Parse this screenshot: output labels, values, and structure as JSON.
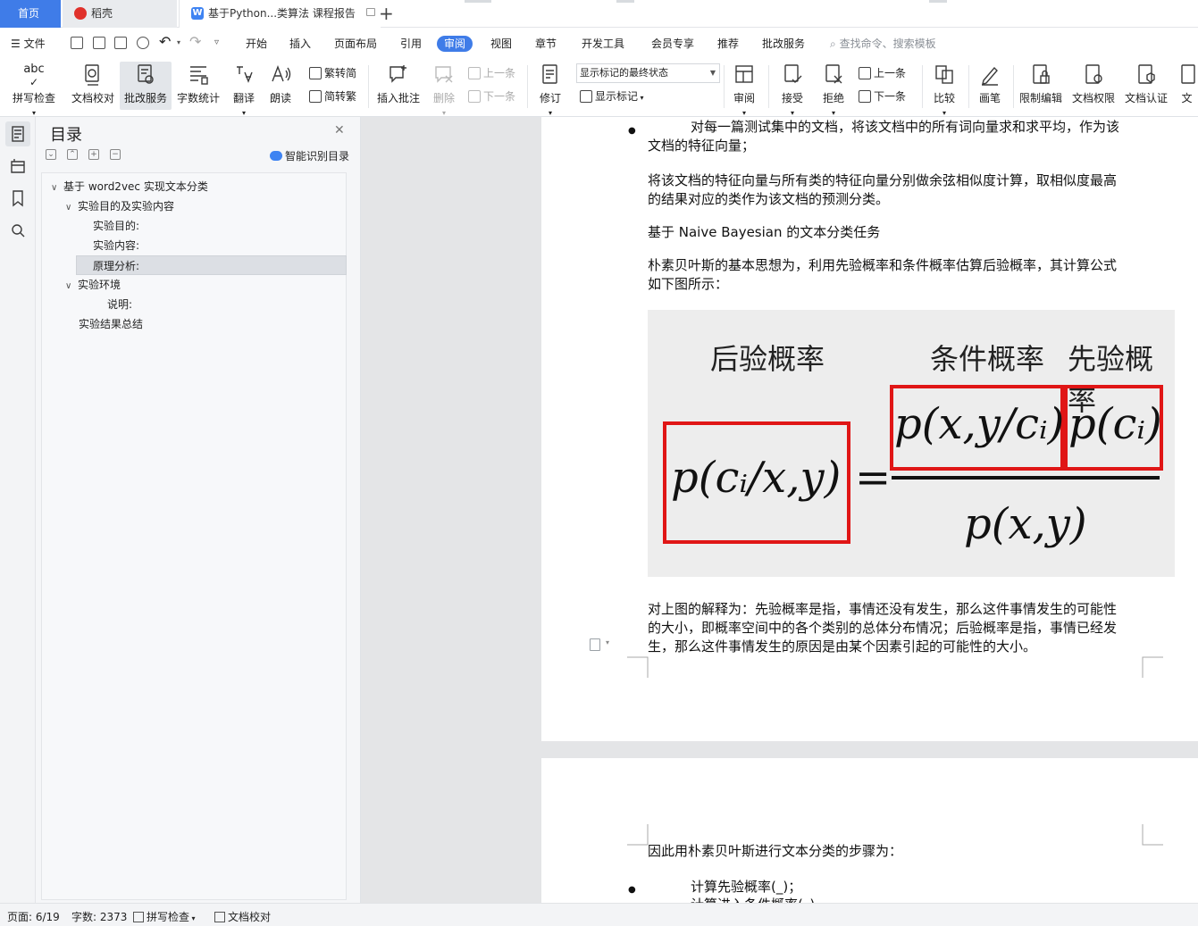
{
  "tabs": {
    "home": "首页",
    "daoke": "稻壳",
    "document": "基于Python...类算法 课程报告"
  },
  "menu": {
    "file": "文件",
    "items": [
      "开始",
      "插入",
      "页面布局",
      "引用",
      "审阅",
      "视图",
      "章节",
      "开发工具",
      "会员专享",
      "推荐",
      "批改服务"
    ],
    "active": "审阅",
    "search_placeholder": "查找命令、搜索模板"
  },
  "ribbon": {
    "spellcheck": "拼写检查",
    "proofread": "文档校对",
    "correction_service": "批改服务",
    "word_count": "字数统计",
    "translate": "翻译",
    "read_aloud": "朗读",
    "trad_to_simp": "繁转简",
    "simp_to_trad": "简转繁",
    "insert_comment": "插入批注",
    "delete": "删除",
    "prev_item": "上一条",
    "next_item": "下一条",
    "track_changes": "修订",
    "markup_mode": "显示标记的最终状态",
    "show_markup": "显示标记",
    "review": "审阅",
    "accept": "接受",
    "reject": "拒绝",
    "prev_change": "上一条",
    "next_change": "下一条",
    "compare": "比较",
    "pen": "画笔",
    "restrict_edit": "限制编辑",
    "doc_permission": "文档权限",
    "doc_certify": "文档认证",
    "doc_more": "文"
  },
  "toc": {
    "title": "目录",
    "smart": "智能识别目录",
    "items": [
      {
        "label": "基于  word2vec  实现文本分类",
        "chevron": "∨"
      },
      {
        "label": "实验目的及实验内容",
        "chevron": "∨"
      },
      {
        "label": "实验目的:",
        "chevron": ""
      },
      {
        "label": "实验内容:",
        "chevron": ""
      },
      {
        "label": "原理分析:",
        "chevron": ""
      },
      {
        "label": "实验环境",
        "chevron": "∨"
      },
      {
        "label": "说明:",
        "chevron": ""
      },
      {
        "label": "实验结果总结",
        "chevron": ""
      }
    ]
  },
  "document": {
    "bullet1_line1": "对每一篇测试集中的文档，将该文档中的所有词向量求和求平均，作为该",
    "bullet1_line2": "文档的特征向量；",
    "para2_line1": "将该文档的特征向量与所有类的特征向量分别做余弦相似度计算，取相似度最高",
    "para2_line2": "的结果对应的类作为该文档的预测分类。",
    "heading_nb": "基于   Naive Bayesian   的文本分类任务",
    "para3_line1": "朴素贝叶斯的基本思想为，利用先验概率和条件概率估算后验概率，其计算公式",
    "para3_line2": "如下图所示：",
    "formula": {
      "label_posterior": "后验概率",
      "label_conditional": "条件概率",
      "label_prior": "先验概率",
      "lhs": "p(cᵢ/x,y)",
      "eq": "=",
      "num1": "p(x,y/cᵢ)",
      "num2": "p(cᵢ)",
      "den": "p(x,y)"
    },
    "para4_line1": "对上图的解释为：先验概率是指，事情还没有发生，那么这件事情发生的可能性",
    "para4_line2": "的大小，即概率空间中的各个类别的总体分布情况；后验概率是指，事情已经发",
    "para4_line3": "生，那么这件事情发生的原因是由某个因素引起的可能性的大小。",
    "page2_intro": "因此用朴素贝叶斯进行文本分类的步骤为：",
    "page2_bullet1": "计算先验概率(_)；",
    "page2_bullet2_partial": "计算进入条件概率(_)"
  },
  "status": {
    "page": "页面: 6/19",
    "words": "字数: 2373",
    "spellcheck": "拼写检查",
    "proofread": "文档校对"
  },
  "colors": {
    "accent": "#3f7ce8",
    "formula_box": "#e01616"
  }
}
